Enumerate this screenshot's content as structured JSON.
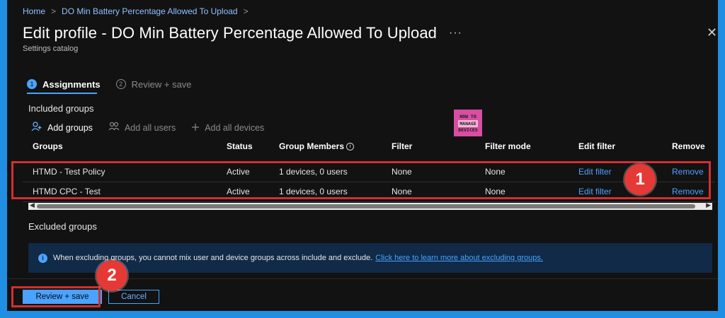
{
  "breadcrumb": {
    "home": "Home",
    "sep1": ">",
    "current": "DO Min Battery Percentage Allowed To Upload",
    "sep2": ">"
  },
  "header": {
    "title": "Edit profile - DO Min Battery Percentage Allowed To Upload",
    "more": "···",
    "subtitle": "Settings catalog",
    "close": "✕"
  },
  "steps": [
    {
      "num": "1",
      "label": "Assignments"
    },
    {
      "num": "2",
      "label": "Review + save"
    }
  ],
  "included": {
    "title": "Included groups",
    "actions": {
      "add_groups": "Add groups",
      "add_all_users": "Add all users",
      "add_all_devices": "Add all devices"
    }
  },
  "logo": {
    "line1": "HOW TO",
    "line2": "MANAGE",
    "line3": "DEVICES"
  },
  "table": {
    "headers": [
      "Groups",
      "Status",
      "Group Members",
      "Filter",
      "Filter mode",
      "Edit filter",
      "Remove"
    ],
    "info_glyph": "i",
    "rows": [
      {
        "group": "HTMD - Test Policy",
        "status": "Active",
        "members": "1 devices, 0 users",
        "filter": "None",
        "filter_mode": "None",
        "edit": "Edit filter",
        "remove": "Remove"
      },
      {
        "group": "HTMD CPC - Test",
        "status": "Active",
        "members": "1 devices, 0 users",
        "filter": "None",
        "filter_mode": "None",
        "edit": "Edit filter",
        "remove": "Remove"
      }
    ]
  },
  "scroll": {
    "left": "◀",
    "right": "▶"
  },
  "excluded": {
    "title": "Excluded groups",
    "info_glyph": "i",
    "banner_text": "When excluding groups, you cannot mix user and device groups across include and exclude.",
    "banner_link": "Click here to learn more about excluding groups."
  },
  "footer": {
    "review_save": "Review + save",
    "cancel": "Cancel"
  },
  "callouts": [
    "1",
    "2"
  ],
  "colors": {
    "accent": "#4aa3ff",
    "highlight": "#d32f2f",
    "callout": "#e53935",
    "background": "#121212",
    "frame": "#1f8ee3"
  }
}
